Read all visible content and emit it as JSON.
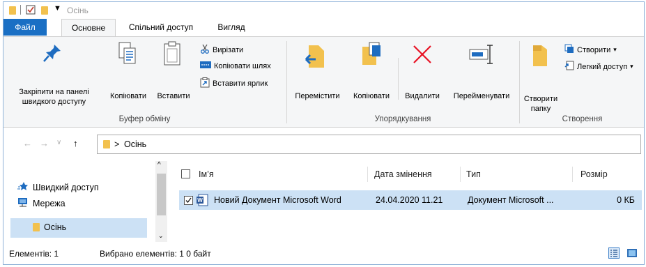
{
  "title": "Осінь",
  "tabs": {
    "file": "Файл",
    "home": "Основне",
    "share": "Спільний доступ",
    "view": "Вигляд"
  },
  "ribbon": {
    "pin_line1": "Закріпити на панелі",
    "pin_line2": "швидкого доступу",
    "copy": "Копіювати",
    "paste": "Вставити",
    "cut": "Вирізати",
    "copy_path": "Копіювати шлях",
    "paste_shortcut": "Вставити ярлик",
    "clipboard_group": "Буфер обміну",
    "move_to": "Перемістити",
    "copy_to": "Копіювати",
    "delete": "Видалити",
    "rename": "Перейменувати",
    "organize_group": "Упорядкування",
    "new_folder_line1": "Створити",
    "new_folder_line2": "папку",
    "new_item": "Створити",
    "easy_access": "Легкий доступ",
    "new_group": "Створення"
  },
  "address": {
    "separator": ">",
    "folder": "Осінь"
  },
  "nav_pane": {
    "quick_access": "Швидкий доступ",
    "network": "Мережа",
    "current": "Осінь"
  },
  "columns": {
    "name": "Ім’я",
    "date": "Дата змінення",
    "type": "Тип",
    "size": "Розмір"
  },
  "files": [
    {
      "name": "Новий Документ Microsoft Word",
      "date": "24.04.2020 11.21",
      "type": "Документ Microsoft ...",
      "size": "0 КБ"
    }
  ],
  "status": {
    "items": "Елементів: 1",
    "selected": "Вибрано елементів: 1  0 байт"
  },
  "colors": {
    "accent": "#1a6fc4",
    "selection": "#cce1f5",
    "folder": "#f2c14e",
    "delete_red": "#e81123"
  }
}
